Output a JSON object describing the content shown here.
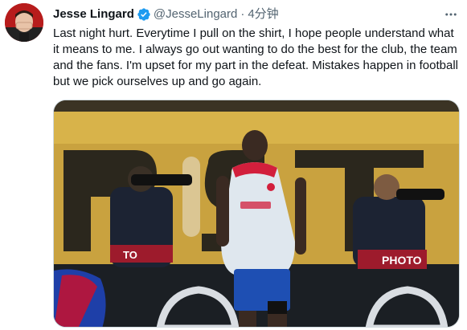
{
  "tweet": {
    "author": {
      "display_name": "Jesse Lingard",
      "handle": "@JesseLingard",
      "verified": true,
      "avatar_icon": "avatar-image"
    },
    "separator": "·",
    "timestamp": "4分钟",
    "more_icon": "more-icon",
    "text": "Last night hurt. Everytime I pull on the shirt, I hope people understand what it means to me. I always go out wanting to do the best for the club, the team and the fans. I'm upset for my part in the defeat. Mistakes happen in football but we pick ourselves up and go again.",
    "media": {
      "banner_text": "PHOTO",
      "colors": {
        "jersey": "#dfe7ee",
        "shorts": "#1e4fb3",
        "stand": "#d8b34a",
        "board": "#1b1f24"
      }
    }
  },
  "colors": {
    "text_primary": "#0f1419",
    "text_secondary": "#536471",
    "verified": "#1d9bf0"
  }
}
